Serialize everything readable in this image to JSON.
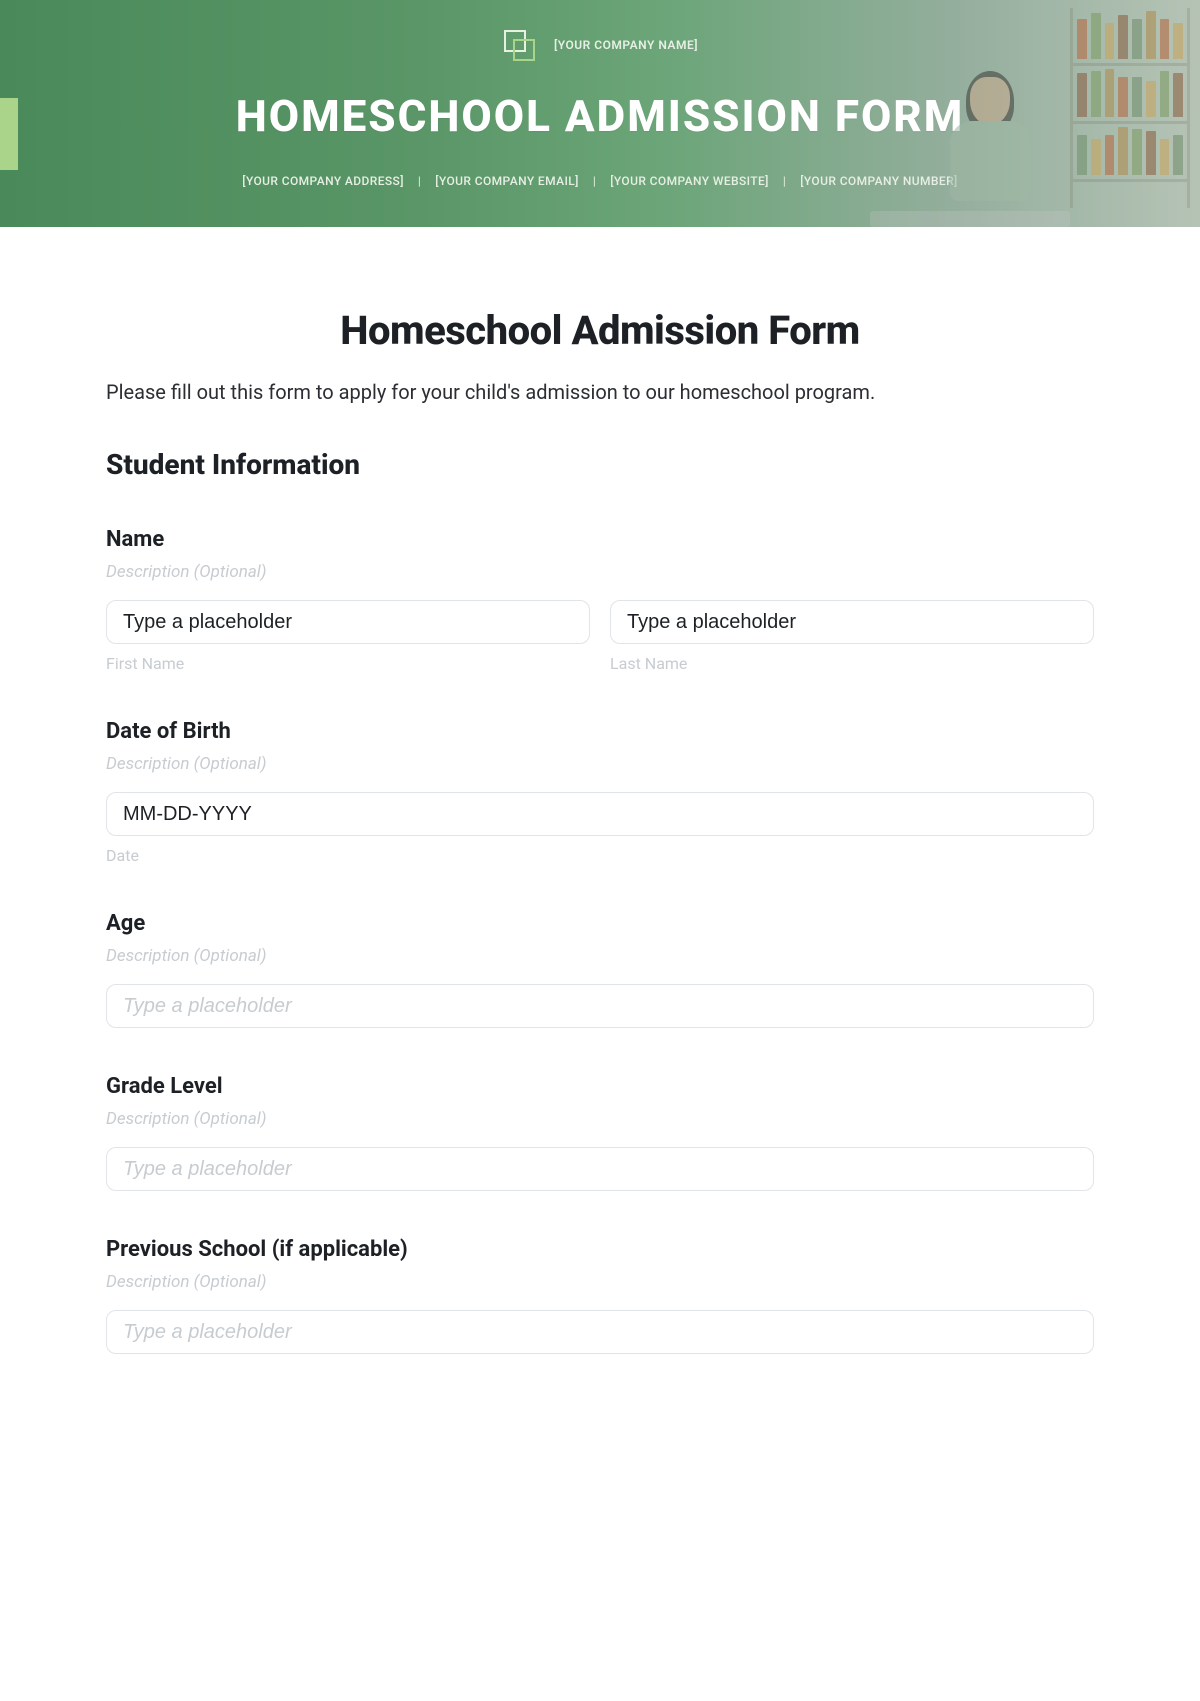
{
  "hero": {
    "company_name": "[YOUR COMPANY NAME]",
    "title": "HOMESCHOOL ADMISSION FORM",
    "meta": {
      "address": "[YOUR COMPANY ADDRESS]",
      "email": "[YOUR COMPANY EMAIL]",
      "website": "[YOUR COMPANY WEBSITE]",
      "number": "[YOUR COMPANY NUMBER]"
    }
  },
  "page": {
    "title": "Homeschool Admission Form",
    "intro": "Please fill out this form to apply for your child's admission to our homeschool program."
  },
  "section": {
    "student_info": "Student Information"
  },
  "fields": {
    "name": {
      "label": "Name",
      "desc": "Description (Optional)",
      "first_placeholder": "Type a placeholder",
      "last_placeholder": "Type a placeholder",
      "first_sub": "First Name",
      "last_sub": "Last Name"
    },
    "dob": {
      "label": "Date of Birth",
      "desc": "Description (Optional)",
      "placeholder": "MM-DD-YYYY",
      "sub": "Date"
    },
    "age": {
      "label": "Age",
      "desc": "Description (Optional)",
      "placeholder": "Type a placeholder"
    },
    "grade": {
      "label": "Grade Level",
      "desc": "Description (Optional)",
      "placeholder": "Type a placeholder"
    },
    "prev_school": {
      "label": "Previous School (if applicable)",
      "desc": "Description (Optional)",
      "placeholder": "Type a placeholder"
    }
  }
}
